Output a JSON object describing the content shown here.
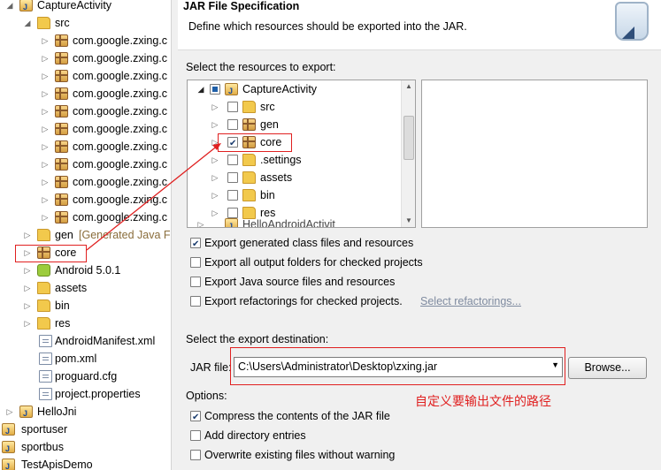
{
  "explorer": {
    "root": "CaptureActivity",
    "src": "src",
    "packages": [
      "com.google.zxing.c",
      "com.google.zxing.c",
      "com.google.zxing.c",
      "com.google.zxing.c",
      "com.google.zxing.c",
      "com.google.zxing.c",
      "com.google.zxing.c",
      "com.google.zxing.c",
      "com.google.zxing.c",
      "com.google.zxing.c",
      "com.google.zxing.c"
    ],
    "gen": "gen",
    "gen_suffix": "[Generated Java F",
    "core": "core",
    "android": "Android 5.0.1",
    "assets": "assets",
    "bin": "bin",
    "res": "res",
    "manifest": "AndroidManifest.xml",
    "pom": "pom.xml",
    "proguard": "proguard.cfg",
    "properties": "project.properties",
    "hellojni": "HelloJni",
    "sportuser": "sportuser",
    "sportbus": "sportbus",
    "testapis": "TestApisDemo"
  },
  "dialog": {
    "title": "JAR File Specification",
    "description": "Define which resources should be exported into the JAR.",
    "resources_label": "Select the resources to export:",
    "tree": {
      "root": "CaptureActivity",
      "items": [
        {
          "label": "src",
          "checked": false
        },
        {
          "label": "gen",
          "checked": false
        },
        {
          "label": "core",
          "checked": true
        },
        {
          "label": ".settings",
          "checked": false
        },
        {
          "label": "assets",
          "checked": false
        },
        {
          "label": "bin",
          "checked": false
        },
        {
          "label": "res",
          "checked": false
        }
      ],
      "cut_item": "HelloAndroidActivit"
    },
    "options1": [
      {
        "label": "Export generated class files and resources",
        "checked": true
      },
      {
        "label": "Export all output folders for checked projects",
        "checked": false
      },
      {
        "label": "Export Java source files and resources",
        "checked": false
      },
      {
        "label": "Export refactorings for checked projects.",
        "checked": false
      }
    ],
    "select_refactorings": "Select refactorings...",
    "destination_label": "Select the export destination:",
    "jar_file_label": "JAR file:",
    "jar_file_value": "C:\\Users\\Administrator\\Desktop\\zxing.jar",
    "browse": "Browse...",
    "annotation": "自定义要输出文件的路径",
    "options_label": "Options:",
    "options2": [
      {
        "label": "Compress the contents of the JAR file",
        "checked": true
      },
      {
        "label": "Add directory entries",
        "checked": false
      },
      {
        "label": "Overwrite existing files without warning",
        "checked": false
      }
    ]
  },
  "colors": {
    "annotation_red": "#e02020"
  }
}
